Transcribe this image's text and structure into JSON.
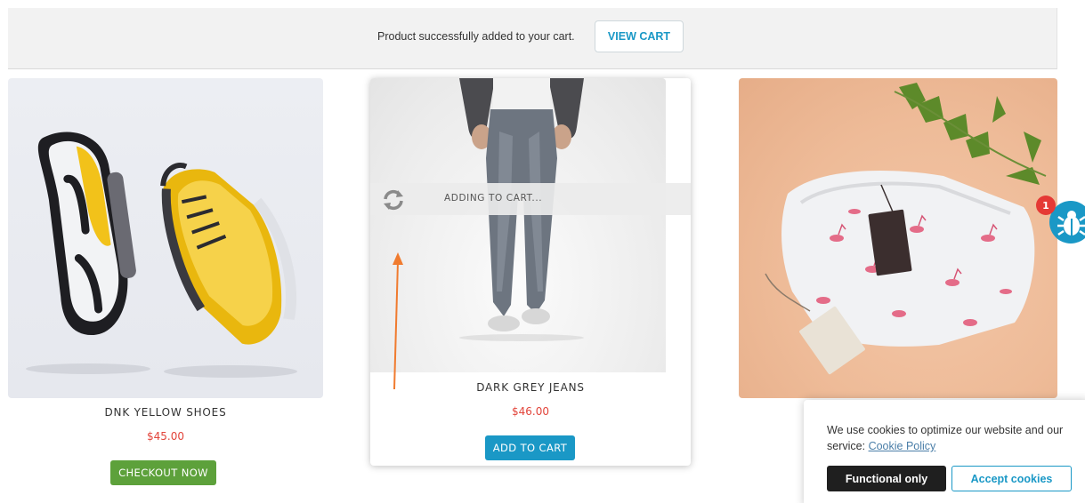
{
  "notice": {
    "message": "Product successfully added to your cart.",
    "view_cart_label": "VIEW CART"
  },
  "products": [
    {
      "name": "DNK YELLOW SHOES",
      "price": "$45.00",
      "button_label": "CHECKOUT NOW",
      "image": "yellow-sneakers"
    },
    {
      "name": "DARK GREY JEANS",
      "price": "$46.00",
      "button_label": "ADD TO CART",
      "image": "grey-jeans",
      "status": "ADDING TO CART..."
    },
    {
      "image": "flamingo-tshirt"
    }
  ],
  "cookie_banner": {
    "text": "We use cookies to optimize our website and our service:",
    "link_label": "Cookie Policy",
    "functional_label": "Functional only",
    "accept_label": "Accept cookies"
  },
  "bug_widget": {
    "badge_count": "1",
    "icon": "bug-icon"
  },
  "annotation": {
    "icon": "arrow-up-icon",
    "color": "#f07b2f"
  },
  "colors": {
    "accent": "#1a98c6",
    "price": "#e2443a",
    "checkout": "#5da13b"
  }
}
